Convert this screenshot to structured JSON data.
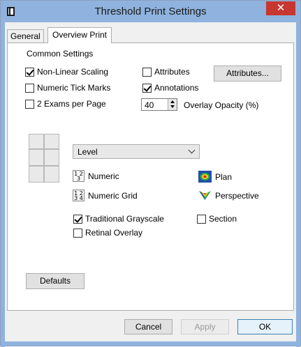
{
  "window": {
    "title": "Threshold Print Settings",
    "close_glyph": "✕"
  },
  "tabs": [
    {
      "label": "General",
      "active": false
    },
    {
      "label": "Overview Print",
      "active": true
    }
  ],
  "common_settings": {
    "label": "Common Settings",
    "non_linear_scaling": {
      "label": "Non-Linear Scaling",
      "checked": true
    },
    "numeric_tick_marks": {
      "label": "Numeric Tick Marks",
      "checked": false
    },
    "two_exams_per_page": {
      "label": "2 Exams per Page",
      "checked": false
    },
    "attributes_check": {
      "label": "Attributes",
      "checked": false
    },
    "annotations": {
      "label": "Annotations",
      "checked": true
    },
    "attributes_button": "Attributes...",
    "overlay_opacity": {
      "value": "40",
      "label": "Overlay Opacity (%)"
    }
  },
  "display": {
    "selected": "Level",
    "numeric": {
      "label": "Numeric",
      "icon": "numeric-icon",
      "glyph_top": "1 2",
      "glyph_bottom": "3"
    },
    "numeric_grid": {
      "label": "Numeric Grid",
      "icon": "numeric-grid-icon",
      "glyph_top": "1 2",
      "glyph_bottom": "3 4"
    },
    "plan": {
      "label": "Plan",
      "icon": "plan-icon"
    },
    "perspective": {
      "label": "Perspective",
      "icon": "perspective-icon"
    },
    "traditional_grayscale": {
      "label": "Traditional Grayscale",
      "checked": true
    },
    "retinal_overlay": {
      "label": "Retinal Overlay",
      "checked": false
    },
    "section": {
      "label": "Section",
      "checked": false
    }
  },
  "buttons": {
    "defaults": "Defaults",
    "cancel": "Cancel",
    "apply": "Apply",
    "ok": "OK"
  },
  "colors": {
    "titlebar": "#8fb3de",
    "close": "#c7372f",
    "ok_border": "#3c7fb1"
  }
}
